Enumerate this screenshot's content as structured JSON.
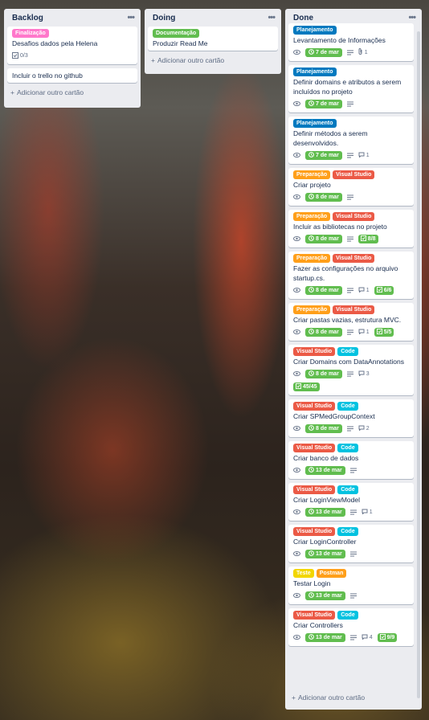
{
  "lists": {
    "backlog": {
      "title": "Backlog",
      "cards": [
        {
          "label": "Finalização",
          "title": "Desafios dados pela Helena",
          "checklist": "0/3"
        },
        {
          "title": "Incluir o trello no github"
        }
      ],
      "add_label": "Adicionar outro cartão"
    },
    "doing": {
      "title": "Doing",
      "cards": [
        {
          "label": "Documentação",
          "title": "Produzir Read Me"
        }
      ],
      "add_label": "Adicionar outro cartão"
    },
    "done": {
      "title": "Done",
      "cards": [
        {
          "labels": [
            "Planejamento"
          ],
          "title": "Levantamento de Informações",
          "due": "7 de mar",
          "attachments": "1"
        },
        {
          "labels": [
            "Planejamento"
          ],
          "title": "Definir domains e atributos a serem incluídos no projeto",
          "due": "7 de mar"
        },
        {
          "labels": [
            "Planejamento"
          ],
          "title": "Definir métodos a serem desenvolvidos.",
          "due": "7 de mar",
          "comments": "1"
        },
        {
          "labels": [
            "Preparação",
            "Visual Studio"
          ],
          "title": "Criar projeto",
          "due": "8 de mar"
        },
        {
          "labels": [
            "Preparação",
            "Visual Studio"
          ],
          "title": "Incluir as bibliotecas no projeto",
          "due": "8 de mar",
          "checklist": "8/8"
        },
        {
          "labels": [
            "Preparação",
            "Visual Studio"
          ],
          "title": "Fazer as configurações no arquivo startup.cs.",
          "due": "8 de mar",
          "comments": "1",
          "checklist": "6/6"
        },
        {
          "labels": [
            "Preparação",
            "Visual Studio"
          ],
          "title": "Criar pastas vazias, estrutura MVC.",
          "due": "8 de mar",
          "comments": "1",
          "checklist": "5/5"
        },
        {
          "labels": [
            "Visual Studio",
            "Code"
          ],
          "title": "Criar Domains com DataAnnotations",
          "due": "8 de mar",
          "comments": "3",
          "checklist": "45/45"
        },
        {
          "labels": [
            "Visual Studio",
            "Code"
          ],
          "title": "Criar SPMedGroupContext",
          "due": "8 de mar",
          "comments": "2"
        },
        {
          "labels": [
            "Visual Studio",
            "Code"
          ],
          "title": "Criar banco de dados",
          "due": "13 de mar"
        },
        {
          "labels": [
            "Visual Studio",
            "Code"
          ],
          "title": "Criar LoginViewModel",
          "due": "13 de mar",
          "comments": "1"
        },
        {
          "labels": [
            "Visual Studio",
            "Code"
          ],
          "title": "Criar LoginController",
          "due": "13 de mar"
        },
        {
          "labels": [
            "Teste",
            "Postman"
          ],
          "title": "Testar Login",
          "due": "13 de mar"
        },
        {
          "labels": [
            "Visual Studio",
            "Code"
          ],
          "title": "Criar Controllers",
          "due": "13 de mar",
          "comments": "4",
          "checklist": "9/9"
        }
      ],
      "add_label": "Adicionar outro cartão"
    }
  },
  "colors": {
    "Finalização": "#ff78cb",
    "Documentação": "#61bd4f",
    "Planejamento": "#0079bf",
    "Preparação": "#ff9f1a",
    "Visual Studio": "#eb5a46",
    "Code": "#00c2e0",
    "Teste": "#f2d600",
    "Postman": "#ff9f1a"
  },
  "icons": {
    "menu": "more-dots-icon",
    "watch": "eye-icon",
    "due": "clock-icon",
    "description": "description-icon",
    "comment": "comment-icon",
    "attachment": "paperclip-icon",
    "checklist": "checklist-icon",
    "add": "plus-icon"
  }
}
